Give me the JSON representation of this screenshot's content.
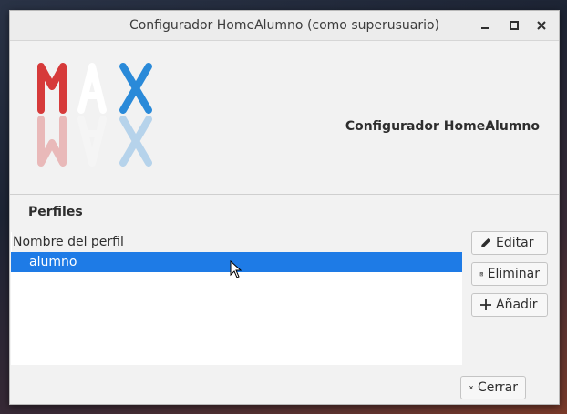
{
  "window": {
    "title": "Configurador HomeAlumno (como superusuario)"
  },
  "header": {
    "logo_letters": [
      "M",
      "A",
      "X"
    ],
    "logo_colors": {
      "M": "#d63a3a",
      "A": "#ffffff",
      "X": "#2a8ad9"
    },
    "title": "Configurador HomeAlumno"
  },
  "profiles": {
    "section_title": "Perfiles",
    "column_header": "Nombre del perfil",
    "items": [
      {
        "label": "alumno",
        "selected": true
      }
    ]
  },
  "buttons": {
    "edit": "Editar",
    "delete": "Eliminar",
    "add": "Añadir",
    "close": "Cerrar"
  },
  "colors": {
    "selection": "#1e7be6"
  }
}
